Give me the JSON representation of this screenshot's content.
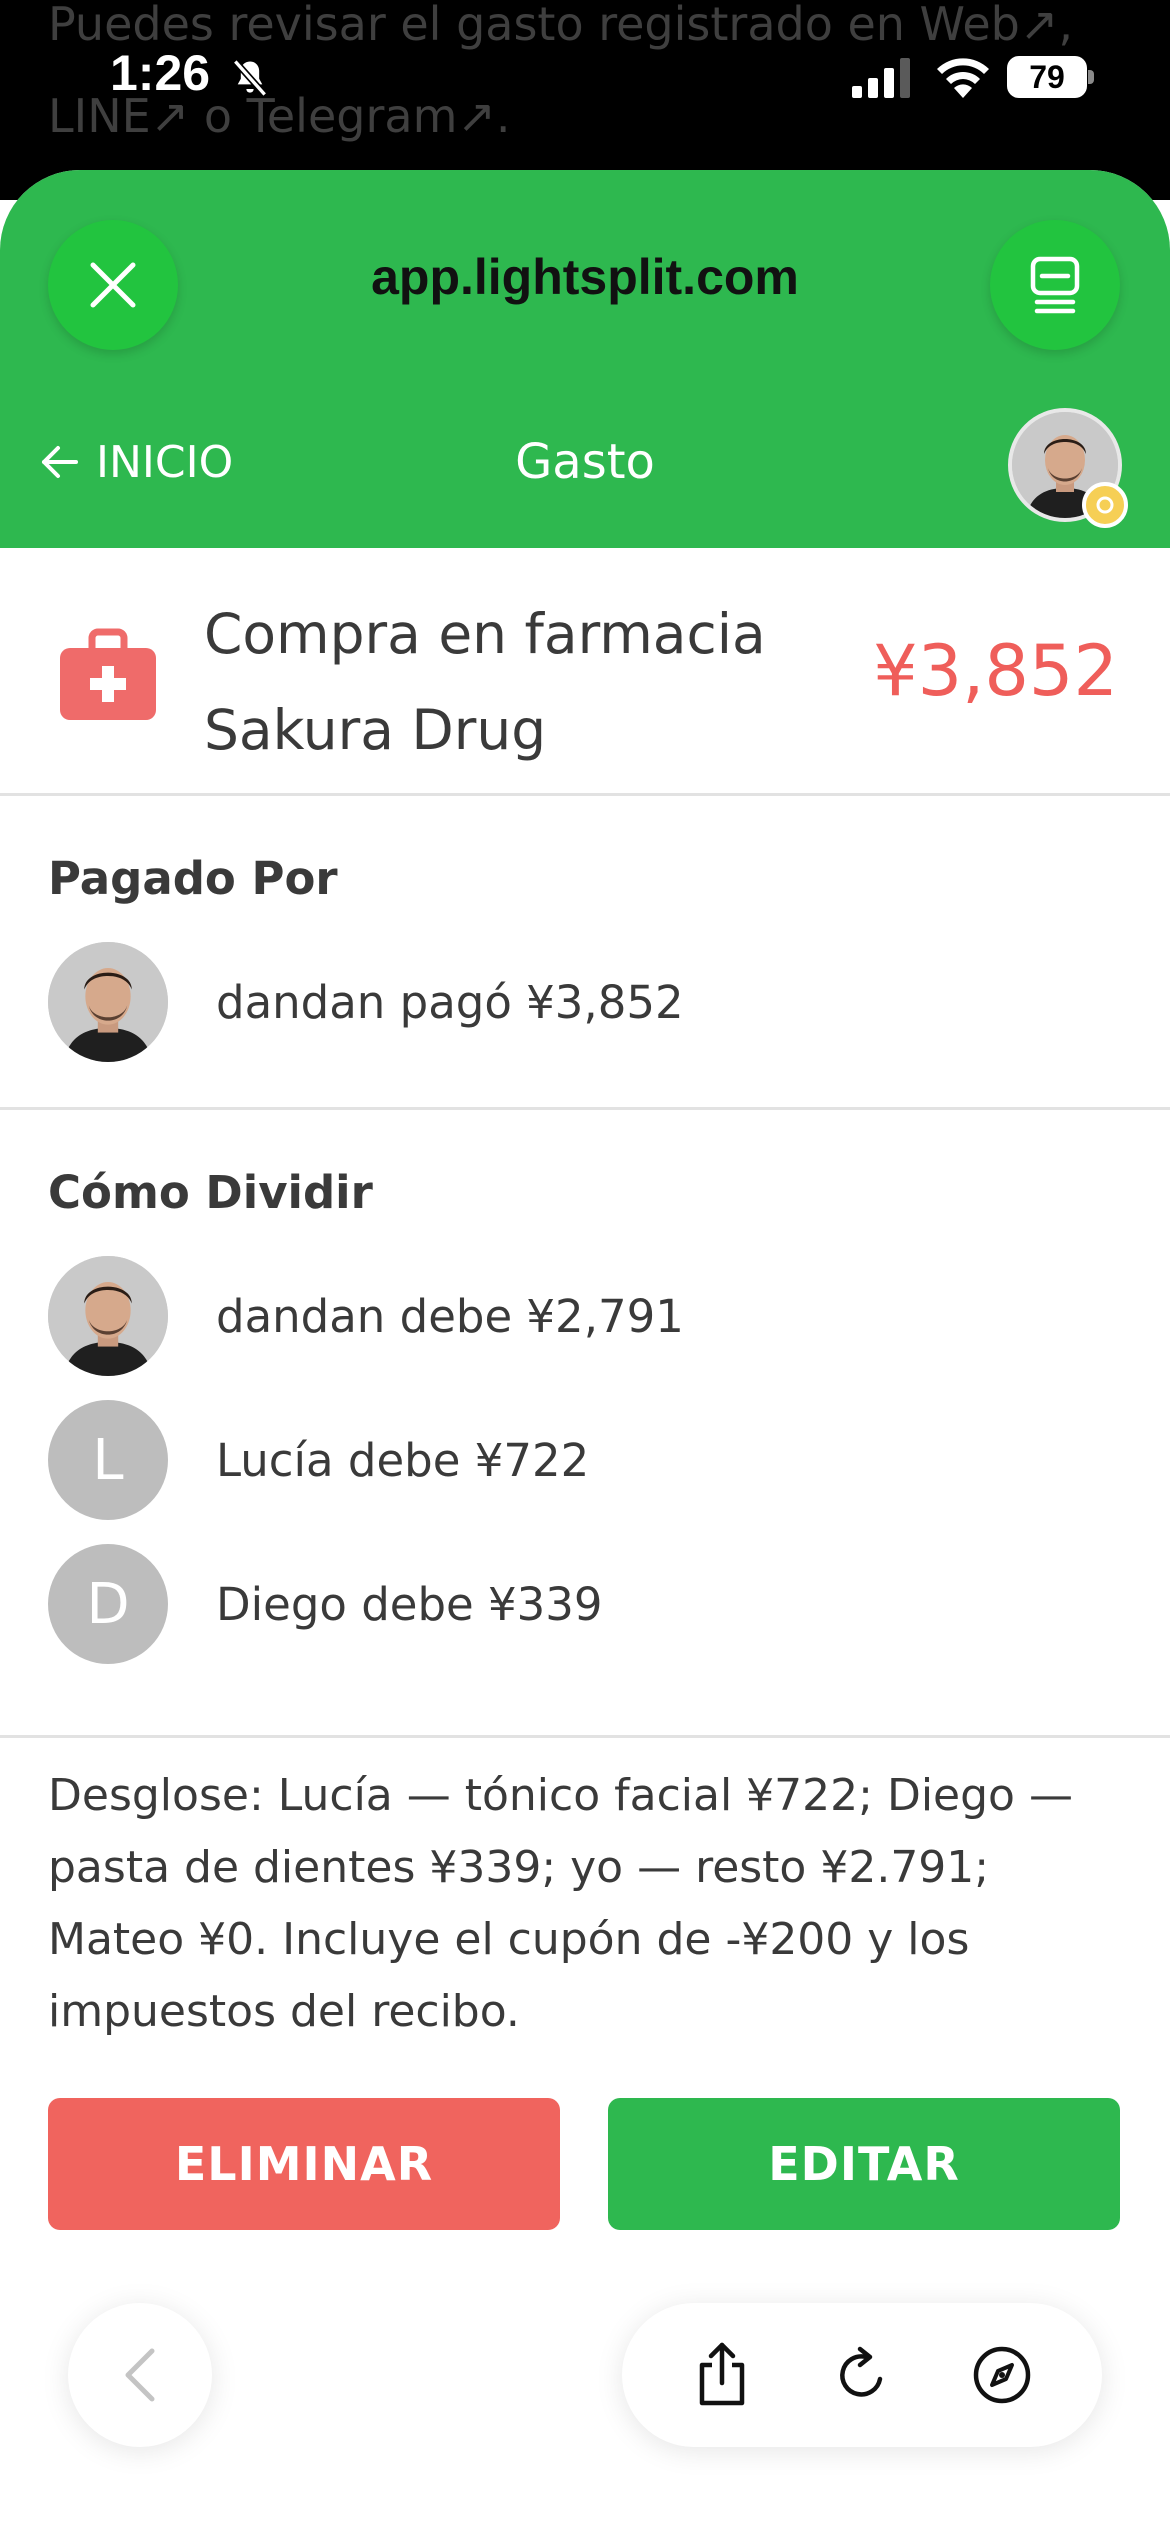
{
  "background_page": {
    "line1": "Puedes revisar el gasto registrado en Web↗,",
    "line2": "LINE↗ o Telegram↗."
  },
  "status_bar": {
    "time": "1:26",
    "battery": "79",
    "icons": [
      "bell-slash-icon",
      "signal-icon",
      "wifi-icon",
      "battery-icon"
    ]
  },
  "browser": {
    "url": "app.lightsplit.com",
    "icons": [
      "close-icon",
      "menu-icon",
      "back-icon",
      "share-icon",
      "reload-icon",
      "compass-icon"
    ]
  },
  "nav": {
    "back_label": "INICIO",
    "title": "Gasto"
  },
  "expense": {
    "title_line1": "Compra en farmacia",
    "title_line2": "Sakura Drug",
    "amount": "¥3,852",
    "icon": "medical-kit-icon",
    "amount_color": "#ef5e5a"
  },
  "paid_by": {
    "title": "Pagado Por",
    "entries": [
      {
        "text": "dandan pagó ¥3,852"
      }
    ]
  },
  "split": {
    "title": "Cómo Dividir",
    "entries": [
      {
        "initial": "",
        "text": "dandan debe ¥2,791"
      },
      {
        "initial": "L",
        "text": "Lucía debe ¥722"
      },
      {
        "initial": "D",
        "text": "Diego debe ¥339"
      }
    ]
  },
  "breakdown": "Desglose: Lucía — tónico facial ¥722; Diego — pasta de dientes ¥339; yo — resto ¥2.791; Mateo ¥0. Incluye el cupón de -¥200 y los impuestos del recibo.",
  "actions": {
    "delete_label": "ELIMINAR",
    "edit_label": "EDITAR",
    "delete_color": "#f0645e",
    "edit_color": "#2eb84f"
  },
  "colors": {
    "brand_green": "#2eb84f",
    "accent_red": "#ef5e5a"
  }
}
